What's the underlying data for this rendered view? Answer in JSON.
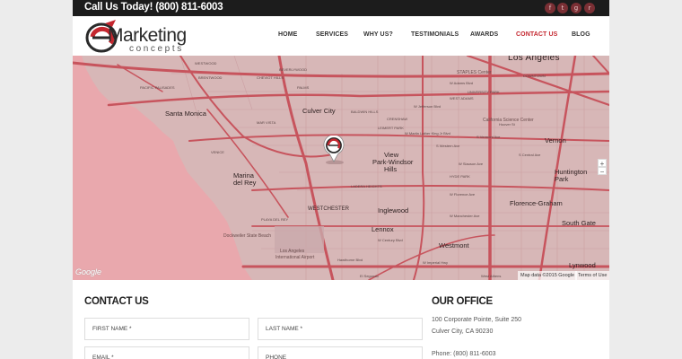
{
  "topbar": {
    "call_text": "Call Us Today! (800) 811-6003",
    "social": [
      {
        "icon": "facebook-icon",
        "glyph": "f"
      },
      {
        "icon": "twitter-icon",
        "glyph": "t"
      },
      {
        "icon": "google-plus-icon",
        "glyph": "g"
      },
      {
        "icon": "rss-icon",
        "glyph": "r"
      }
    ]
  },
  "logo": {
    "word1": "Marketing",
    "word2": "concepts",
    "letter": "e"
  },
  "nav": {
    "items": [
      {
        "label": "HOME"
      },
      {
        "label": "SERVICES"
      },
      {
        "label": "WHY US?"
      },
      {
        "label": "TESTIMONIALS"
      },
      {
        "label": "AWARDS"
      },
      {
        "label": "CONTACT US",
        "active": true
      },
      {
        "label": "BLOG"
      }
    ]
  },
  "map": {
    "labels": {
      "los_angeles": "Los Angeles",
      "santa_monica": "Santa Monica",
      "culver_city": "Culver City",
      "view_park": "View",
      "view_park2": "Park-Windsor",
      "view_park3": "Hills",
      "marina_del_rey": "Marina",
      "marina_del_rey2": "del Rey",
      "inglewood": "Inglewood",
      "westchester": "WESTCHESTER",
      "lennox": "Lennox",
      "westmont": "Westmont",
      "huntington_park": "Huntington",
      "huntington_park2": "Park",
      "vernon": "Vernon",
      "florence": "Florence-Graham",
      "south_gate": "South Gate",
      "lynwood": "Lynwood",
      "playa_del_rey": "PLAYA DEL REY",
      "dockweiler": "Dockweiler State Beach",
      "lax": "Los Angeles",
      "lax2": "International Airport",
      "venice": "VENICE",
      "mar_vista": "MAR VISTA",
      "palms": "PALMS",
      "west_adams": "WEST ADAMS",
      "ladera": "LADERA HEIGHTS",
      "hyde_park": "HYDE PARK",
      "leimert": "LEIMERT PARK",
      "california_science_center": "California Science Center",
      "staples": "STAPLES Center",
      "university_park": "UNIVERSITY PARK",
      "downtown": "DOWNTOWN",
      "westwood": "WESTWOOD",
      "beverlywood": "BEVERLYWOOD",
      "cheviot": "CHEVIOT HILLS",
      "baldwin": "BALDWIN HILLS",
      "crenshaw": "CRENSHAW",
      "jefferson": "W Jefferson Blvd",
      "adams": "W Adams Blvd",
      "mlk": "W Martin Luther King Jr Blvd",
      "slauson": "W Slauson Ave",
      "florence_ave": "W Florence Ave",
      "manchester": "W Manchester Ave",
      "century": "W Century Blvd",
      "imperial": "W Imperial Hwy",
      "athens": "West Athens",
      "el_segundo": "El Segundo",
      "hawthorne": "Hawthorne Blvd",
      "pacific_palisades": "PACIFIC PALISADES",
      "brentwood": "BRENTWOOD",
      "central_ave": "S Central Ave",
      "vermont": "S Vermont Ave",
      "western": "S Western Ave",
      "hoover": "Hoover St",
      "mapdata": "Map data ©2015 Google",
      "terms": "Terms of Use",
      "google": "Google"
    },
    "zoom_in": "+",
    "zoom_out": "−",
    "pin_letter": "e"
  },
  "contact": {
    "title": "CONTACT US",
    "first_name": "FIRST NAME *",
    "last_name": "LAST NAME *",
    "email": "EMAIL *",
    "phone": "PHONE"
  },
  "office": {
    "title": "OUR OFFICE",
    "address1": "100 Corporate Pointe, Suite 250",
    "address2": "Culver City, CA 90230",
    "phone": "Phone: (800) 811-6003"
  },
  "colors": {
    "accent": "#c4272f",
    "topbar": "#1c1c1c",
    "map_land": "#d7b7b7",
    "map_water": "#e9a8ad",
    "map_road": "#c7545d"
  }
}
